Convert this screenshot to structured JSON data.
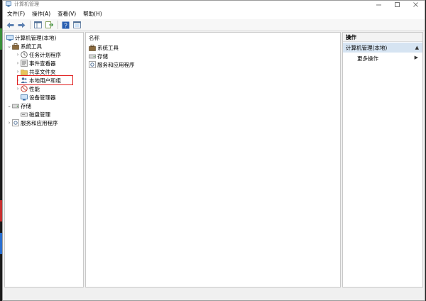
{
  "window": {
    "title": "计算机管理"
  },
  "menu": [
    {
      "label": "文件(F)"
    },
    {
      "label": "操作(A)"
    },
    {
      "label": "查看(V)"
    },
    {
      "label": "帮助(H)"
    }
  ],
  "tree": {
    "root": "计算机管理(本地)",
    "system_tools": "系统工具",
    "task_scheduler": "任务计划程序",
    "event_viewer": "事件查看器",
    "shared_folders": "共享文件夹",
    "local_users": "本地用户和组",
    "performance": "性能",
    "device_manager": "设备管理器",
    "storage": "存储",
    "disk_management": "磁盘管理",
    "services_apps": "服务和应用程序"
  },
  "center": {
    "column_name": "名称",
    "items": [
      {
        "label": "系统工具"
      },
      {
        "label": "存储"
      },
      {
        "label": "服务和应用程序"
      }
    ]
  },
  "actions": {
    "title": "操作",
    "section": "计算机管理(本地)",
    "more": "更多操作"
  },
  "colors": {
    "highlight": "#e02020",
    "section_bg": "#d6e4f2"
  }
}
